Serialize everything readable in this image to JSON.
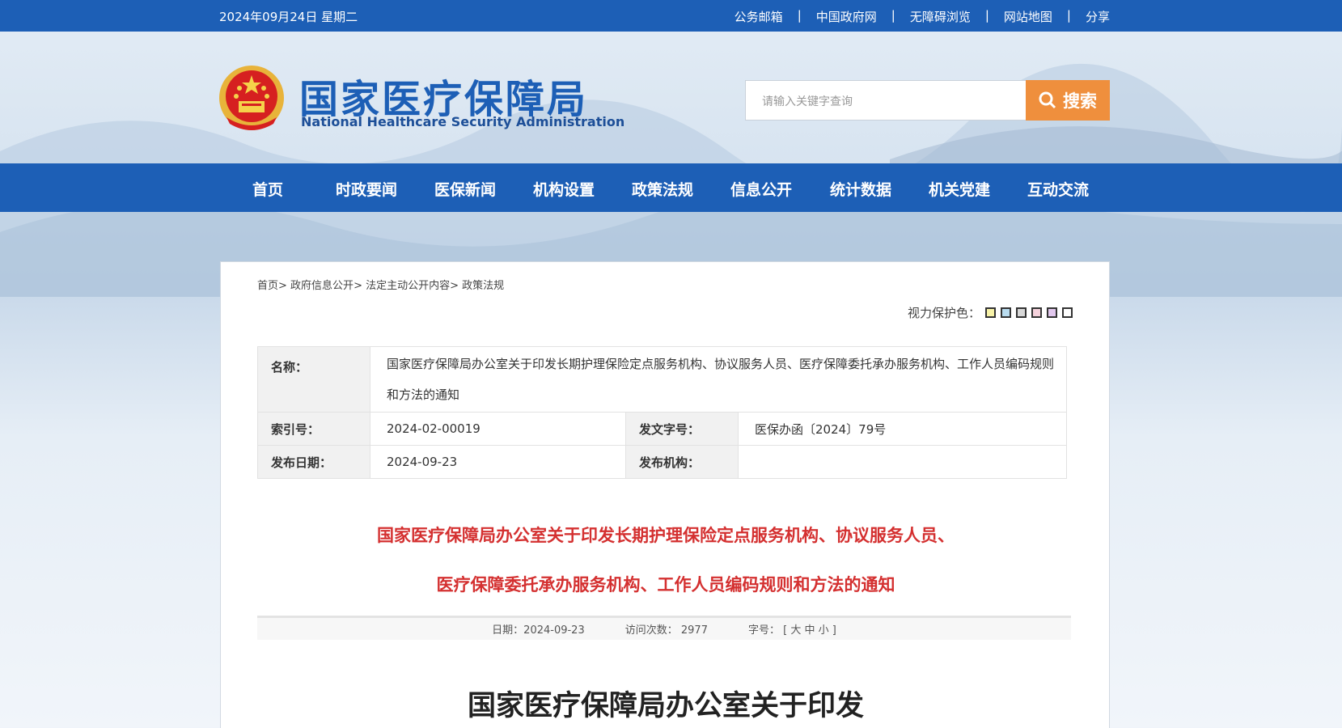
{
  "topbar": {
    "date": "2024年09月24日 星期二",
    "links": [
      "公务邮箱",
      "中国政府网",
      "无障碍浏览",
      "网站地图",
      "分享"
    ],
    "separator": "|"
  },
  "logo": {
    "cn": "国家医疗保障局",
    "en": "National Healthcare Security Administration"
  },
  "search": {
    "placeholder": "请输入关键字查询",
    "button_label": "搜索"
  },
  "nav": [
    "首页",
    "时政要闻",
    "医保新闻",
    "机构设置",
    "政策法规",
    "信息公开",
    "统计数据",
    "机关党建",
    "互动交流"
  ],
  "breadcrumb": [
    "首页",
    "政府信息公开",
    "法定主动公开内容",
    "政策法规"
  ],
  "eye_protect": {
    "label": "视力保护色：",
    "swatches": [
      "#f8f3a8",
      "#b9dcef",
      "#d8d8d8",
      "#f5d2dc",
      "#e2c8ee",
      "#ffffff"
    ]
  },
  "meta": {
    "name_label": "名称：",
    "name_value": "国家医疗保障局办公室关于印发长期护理保险定点服务机构、协议服务人员、医疗保障委托承办服务机构、工作人员编码规则和方法的通知",
    "index_label": "索引号：",
    "index_value": "2024-02-00019",
    "docno_label": "发文字号：",
    "docno_value": "医保办函〔2024〕79号",
    "date_label": "发布日期：",
    "date_value": "2024-09-23",
    "org_label": "发布机构：",
    "org_value": ""
  },
  "article": {
    "title_line1": "国家医疗保障局办公室关于印发长期护理保险定点服务机构、协议服务人员、",
    "title_line2": "医疗保障委托承办服务机构、工作人员编码规则和方法的通知",
    "date_text": "日期：2024-09-23",
    "visits_label": "访问次数：",
    "visits_value": "2977",
    "font_label": "字号：",
    "font_options": "[ 大 中 小 ]",
    "doc_heading": "国家医疗保障局办公室关于印发"
  },
  "colors": {
    "brand_blue": "#1d5fb6",
    "search_orange": "#ef8f3d",
    "title_red": "#d43030"
  }
}
